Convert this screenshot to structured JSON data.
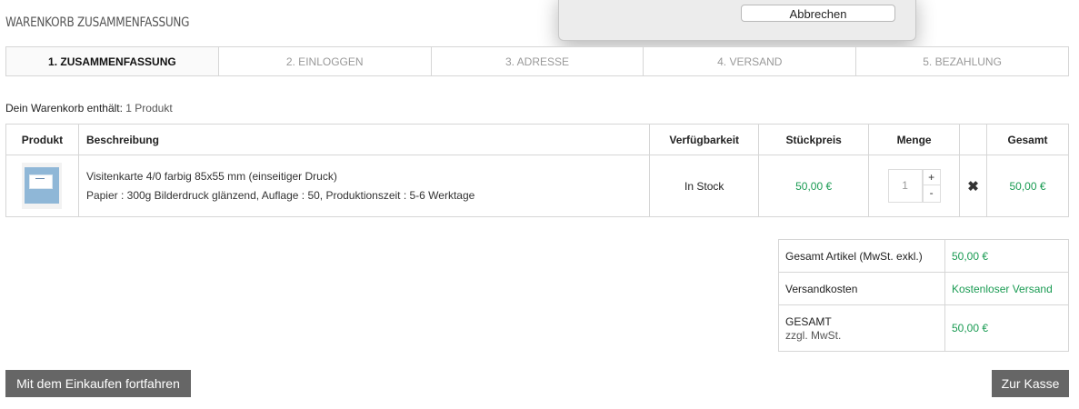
{
  "page": {
    "title": "WARENKORB ZUSAMMENFASSUNG"
  },
  "dialog": {
    "cancel_label": "Abbrechen"
  },
  "steps": [
    {
      "label": "1. ZUSAMMENFASSUNG",
      "active": true
    },
    {
      "label": "2. EINLOGGEN",
      "active": false
    },
    {
      "label": "3. ADRESSE",
      "active": false
    },
    {
      "label": "4. VERSAND",
      "active": false
    },
    {
      "label": "5. BEZAHLUNG",
      "active": false
    }
  ],
  "cart_summary": {
    "prefix": "Dein Warenkorb enthält:",
    "count": "1 Produkt"
  },
  "cart_table": {
    "headers": {
      "product": "Produkt",
      "description": "Beschreibung",
      "availability": "Verfügbarkeit",
      "unit_price": "Stückpreis",
      "quantity": "Menge",
      "total": "Gesamt"
    },
    "rows": [
      {
        "thumbnail_icon": "business-card-thumbnail",
        "name": "Visitenkarte 4/0 farbig 85x55 mm (einseitiger Druck)",
        "details": "Papier : 300g Bilderdruck glänzend, Auflage : 50, Produktionszeit : 5-6 Werktage",
        "availability": "In Stock",
        "unit_price": "50,00 €",
        "quantity": "1",
        "increment_label": "+",
        "decrement_label": "-",
        "remove_icon": "✖",
        "total": "50,00 €"
      }
    ]
  },
  "totals": {
    "items_label": "Gesamt Artikel (MwSt. exkl.)",
    "items_value": "50,00 €",
    "shipping_label": "Versandkosten",
    "shipping_value": "Kostenloser Versand",
    "total_label": "GESAMT",
    "total_sub": "zzgl. MwSt.",
    "total_value": "50,00 €"
  },
  "buttons": {
    "continue_label": "Mit dem Einkaufen fortfahren",
    "checkout_label": "Zur Kasse"
  },
  "colors": {
    "price_green": "#1a9b53",
    "button_gray": "#666666"
  }
}
